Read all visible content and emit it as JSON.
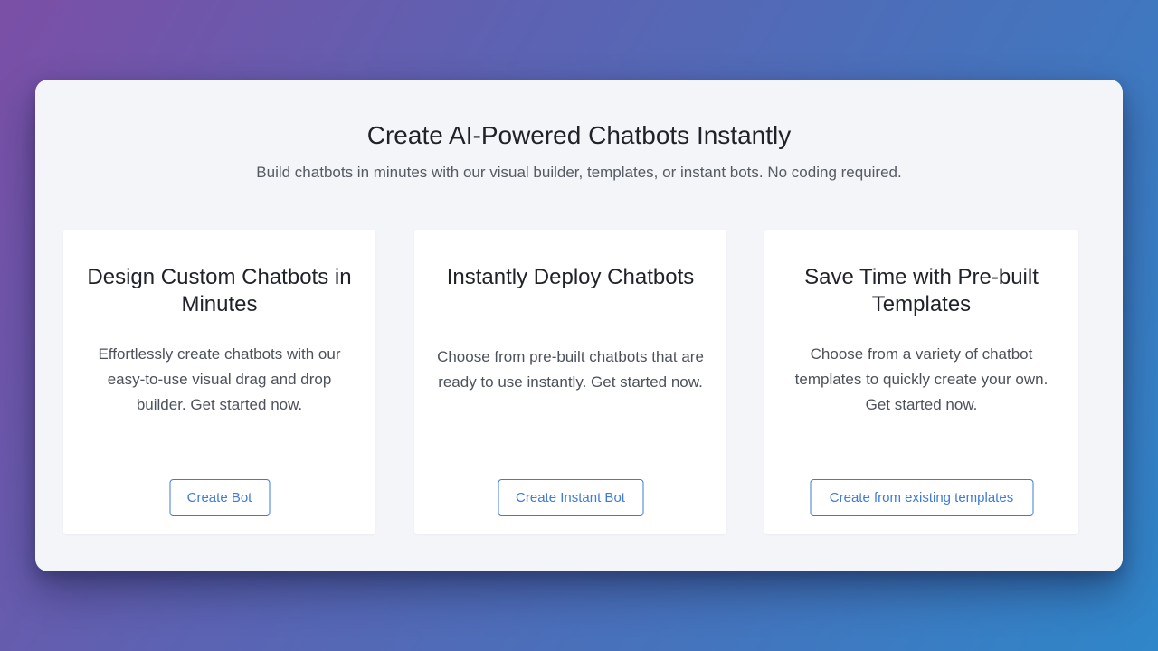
{
  "hero": {
    "title": "Create AI-Powered Chatbots Instantly",
    "subtitle": "Build chatbots in minutes with our visual builder, templates, or instant bots. No coding required."
  },
  "cards": [
    {
      "title": "Design Custom Chatbots in Minutes",
      "description": "Effortlessly create chatbots with our easy-to-use visual drag and drop builder. Get started now.",
      "button_label": "Create Bot"
    },
    {
      "title": "Instantly Deploy Chatbots",
      "description": "Choose from pre-built chatbots that are ready to use instantly. Get started now.",
      "button_label": "Create Instant Bot"
    },
    {
      "title": "Save Time with Pre-built Templates",
      "description": "Choose from a variety of chatbot templates to quickly create your own. Get started now.",
      "button_label": "Create from existing templates"
    }
  ],
  "colors": {
    "accent": "#3e7bd6",
    "panel_background": "#f4f5f8",
    "card_background": "#ffffff",
    "heading_text": "#1f2228",
    "body_text": "#4d525a"
  }
}
